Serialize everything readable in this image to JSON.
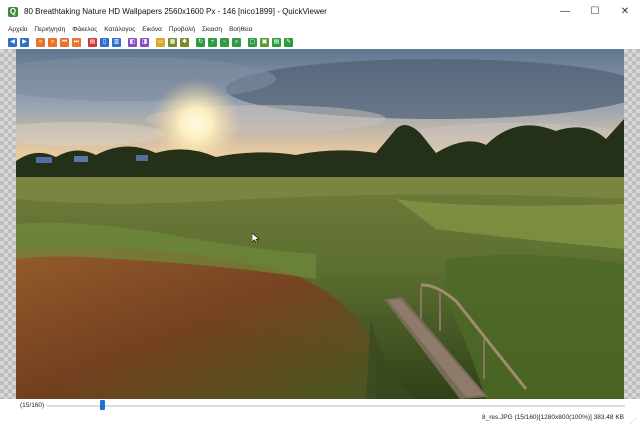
{
  "window": {
    "title": "80 Breathtaking Nature HD Wallpapers 2560x1600 Px - 146 [nico1899] - QuickViewer",
    "app_icon_glyph": "Q",
    "controls": [
      "—",
      "☐",
      "✕"
    ]
  },
  "menu": {
    "items": [
      "Αρχείο",
      "Περιήγηση",
      "Φάκελος",
      "Κατάλογος",
      "Εικόνα",
      "Προβολή",
      "Σκιαση",
      "Βοήθεια"
    ]
  },
  "toolbar": {
    "buttons": [
      {
        "name": "first-page",
        "color": "#2e6fc9",
        "glyph": "◀"
      },
      {
        "name": "next-page",
        "color": "#2e6fc9",
        "glyph": "▶"
      },
      {
        "name": "prev-folder",
        "color": "#e8732c",
        "glyph": "«"
      },
      {
        "name": "next-folder",
        "color": "#e8732c",
        "glyph": "»"
      },
      {
        "name": "prev-archive",
        "color": "#e8732c",
        "glyph": "⏮"
      },
      {
        "name": "next-archive",
        "color": "#e8732c",
        "glyph": "⏭"
      },
      {
        "name": "catalog",
        "color": "#c93a3a",
        "glyph": "▤"
      },
      {
        "name": "single-page",
        "color": "#2e6fc9",
        "glyph": "▯"
      },
      {
        "name": "dual-page",
        "color": "#2e6fc9",
        "glyph": "▥"
      },
      {
        "name": "right-to-left",
        "color": "#8a4cc2",
        "glyph": "◧"
      },
      {
        "name": "left-to-right",
        "color": "#8a4cc2",
        "glyph": "◨"
      },
      {
        "name": "open-folder",
        "color": "#d9a52a",
        "glyph": "▭"
      },
      {
        "name": "bookmark",
        "color": "#7a8a2a",
        "glyph": "▦"
      },
      {
        "name": "settings",
        "color": "#7a8a2a",
        "glyph": "✱"
      },
      {
        "name": "refresh",
        "color": "#2f9a3f",
        "glyph": "↻"
      },
      {
        "name": "zoom-in",
        "color": "#2f9a3f",
        "glyph": "+"
      },
      {
        "name": "zoom-out",
        "color": "#2f9a3f",
        "glyph": "−"
      },
      {
        "name": "zoom-fit",
        "color": "#2f9a3f",
        "glyph": "⌕"
      },
      {
        "name": "fit-window",
        "color": "#2f9a3f",
        "glyph": "▢"
      },
      {
        "name": "fullscreen",
        "color": "#5a9a2f",
        "glyph": "▣"
      },
      {
        "name": "slideshow",
        "color": "#2f9a3f",
        "glyph": "▤"
      },
      {
        "name": "pin",
        "color": "#2f9a3f",
        "glyph": "✎"
      }
    ]
  },
  "status": {
    "position": "(15/160)",
    "slider_fraction": 0.0917,
    "info": "8_res.JPG (15/160)[1280x800(100%)] 383.48 KB"
  }
}
